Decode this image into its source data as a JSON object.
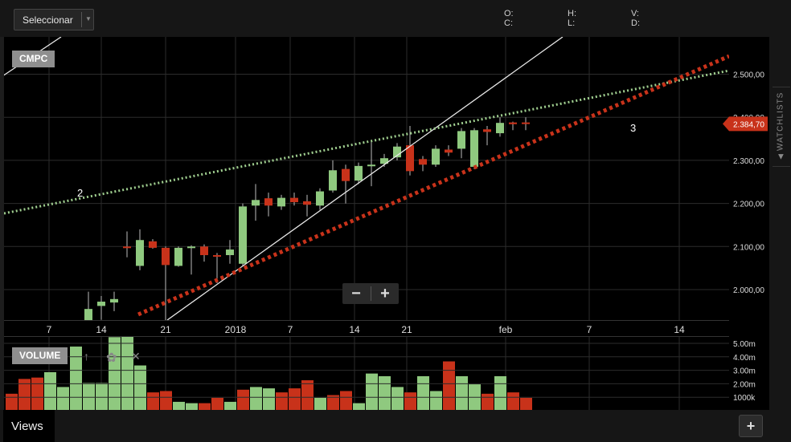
{
  "toolbar": {
    "select_label": "Seleccionar"
  },
  "ohlc_labels": {
    "o": "O:",
    "c": "C:",
    "h": "H:",
    "l": "L:",
    "v": "V:",
    "d": "D:"
  },
  "sidebar": {
    "watchlists_label": "WATCHLISTS"
  },
  "footer": {
    "views_label": "Views",
    "add_label": "+"
  },
  "zoom": {
    "minus": "−",
    "plus": "+"
  },
  "volume_panel": {
    "label": "VOLUME"
  },
  "colors": {
    "up": "#8fc97f",
    "down": "#c8321a",
    "background": "#000000",
    "price_tag": "#c8321a",
    "support_line": "#c8321a",
    "resistance_line": "#9fce8f"
  },
  "chart_data": {
    "type": "candlestick",
    "symbol": "CMPC",
    "last_price_label": "2.384,70",
    "last_price": 2384.7,
    "y_ticks": [
      "2.500,00",
      "2.400,00",
      "2.300,00",
      "2.200,00",
      "2.100,00",
      "2.000,00"
    ],
    "y_values": [
      2500,
      2400,
      2300,
      2200,
      2100,
      2000
    ],
    "x_ticks": [
      "7",
      "14",
      "21",
      "2018",
      "7",
      "14",
      "21",
      "feb",
      "7",
      "14"
    ],
    "ylim": [
      1927,
      2597
    ],
    "candles": [
      {
        "o": 1920,
        "h": 1995,
        "l": 1900,
        "c": 1955
      },
      {
        "o": 1962,
        "h": 1985,
        "l": 1930,
        "c": 1972
      },
      {
        "o": 1970,
        "h": 1995,
        "l": 1950,
        "c": 1978
      },
      {
        "o": 2100,
        "h": 2135,
        "l": 2075,
        "c": 2098
      },
      {
        "o": 2055,
        "h": 2140,
        "l": 2045,
        "c": 2115
      },
      {
        "o": 2112,
        "h": 2117,
        "l": 2095,
        "c": 2097
      },
      {
        "o": 2097,
        "h": 2100,
        "l": 1900,
        "c": 2057
      },
      {
        "o": 2055,
        "h": 2100,
        "l": 2053,
        "c": 2097
      },
      {
        "o": 2098,
        "h": 2103,
        "l": 2035,
        "c": 2100
      },
      {
        "o": 2100,
        "h": 2105,
        "l": 2065,
        "c": 2080
      },
      {
        "o": 2080,
        "h": 2085,
        "l": 2015,
        "c": 2078
      },
      {
        "o": 2080,
        "h": 2115,
        "l": 2060,
        "c": 2093
      },
      {
        "o": 2060,
        "h": 2200,
        "l": 2055,
        "c": 2193
      },
      {
        "o": 2195,
        "h": 2245,
        "l": 2160,
        "c": 2208
      },
      {
        "o": 2212,
        "h": 2225,
        "l": 2170,
        "c": 2195
      },
      {
        "o": 2193,
        "h": 2220,
        "l": 2185,
        "c": 2213
      },
      {
        "o": 2213,
        "h": 2225,
        "l": 2195,
        "c": 2203
      },
      {
        "o": 2205,
        "h": 2220,
        "l": 2170,
        "c": 2197
      },
      {
        "o": 2195,
        "h": 2235,
        "l": 2185,
        "c": 2228
      },
      {
        "o": 2230,
        "h": 2300,
        "l": 2225,
        "c": 2277
      },
      {
        "o": 2280,
        "h": 2290,
        "l": 2200,
        "c": 2252
      },
      {
        "o": 2253,
        "h": 2295,
        "l": 2245,
        "c": 2287
      },
      {
        "o": 2288,
        "h": 2345,
        "l": 2240,
        "c": 2290
      },
      {
        "o": 2292,
        "h": 2315,
        "l": 2285,
        "c": 2305
      },
      {
        "o": 2307,
        "h": 2340,
        "l": 2300,
        "c": 2332
      },
      {
        "o": 2335,
        "h": 2380,
        "l": 2265,
        "c": 2275
      },
      {
        "o": 2303,
        "h": 2310,
        "l": 2275,
        "c": 2290
      },
      {
        "o": 2290,
        "h": 2335,
        "l": 2285,
        "c": 2327
      },
      {
        "o": 2325,
        "h": 2335,
        "l": 2310,
        "c": 2318
      },
      {
        "o": 2327,
        "h": 2375,
        "l": 2305,
        "c": 2368
      },
      {
        "o": 2285,
        "h": 2375,
        "l": 2280,
        "c": 2370
      },
      {
        "o": 2372,
        "h": 2380,
        "l": 2335,
        "c": 2366
      },
      {
        "o": 2363,
        "h": 2400,
        "l": 2355,
        "c": 2387
      },
      {
        "o": 2388,
        "h": 2390,
        "l": 2370,
        "c": 2384
      },
      {
        "o": 2388,
        "h": 2400,
        "l": 2370,
        "c": 2385
      }
    ],
    "volume_ticks": [
      "5.00m",
      "4.00m",
      "3.00m",
      "2.00m",
      "1000k"
    ],
    "volume": [
      {
        "v": 1.2,
        "d": "down"
      },
      {
        "v": 2.3,
        "d": "down"
      },
      {
        "v": 2.4,
        "d": "down"
      },
      {
        "v": 2.8,
        "d": "up"
      },
      {
        "v": 1.7,
        "d": "up"
      },
      {
        "v": 4.7,
        "d": "up"
      },
      {
        "v": 2.0,
        "d": "up"
      },
      {
        "v": 2.0,
        "d": "up"
      },
      {
        "v": 5.4,
        "d": "up"
      },
      {
        "v": 5.6,
        "d": "up"
      },
      {
        "v": 3.3,
        "d": "up"
      },
      {
        "v": 1.3,
        "d": "down"
      },
      {
        "v": 1.4,
        "d": "down"
      },
      {
        "v": 0.6,
        "d": "up"
      },
      {
        "v": 0.5,
        "d": "up"
      },
      {
        "v": 0.5,
        "d": "down"
      },
      {
        "v": 0.9,
        "d": "down"
      },
      {
        "v": 0.6,
        "d": "up"
      },
      {
        "v": 1.5,
        "d": "down"
      },
      {
        "v": 1.7,
        "d": "up"
      },
      {
        "v": 1.6,
        "d": "up"
      },
      {
        "v": 1.3,
        "d": "down"
      },
      {
        "v": 1.6,
        "d": "down"
      },
      {
        "v": 2.2,
        "d": "down"
      },
      {
        "v": 0.9,
        "d": "up"
      },
      {
        "v": 1.1,
        "d": "down"
      },
      {
        "v": 1.4,
        "d": "down"
      },
      {
        "v": 0.5,
        "d": "up"
      },
      {
        "v": 2.7,
        "d": "up"
      },
      {
        "v": 2.5,
        "d": "up"
      },
      {
        "v": 1.7,
        "d": "up"
      },
      {
        "v": 1.3,
        "d": "down"
      },
      {
        "v": 2.5,
        "d": "up"
      },
      {
        "v": 1.4,
        "d": "up"
      },
      {
        "v": 3.6,
        "d": "down"
      },
      {
        "v": 2.5,
        "d": "up"
      },
      {
        "v": 1.9,
        "d": "up"
      },
      {
        "v": 1.2,
        "d": "down"
      },
      {
        "v": 2.5,
        "d": "up"
      },
      {
        "v": 1.3,
        "d": "down"
      },
      {
        "v": 0.9,
        "d": "down"
      }
    ],
    "annotations": [
      "2",
      "3"
    ],
    "trend_lines": [
      {
        "name": "resistance",
        "style": "dotted",
        "color": "#9fce8f"
      },
      {
        "name": "support",
        "style": "dotted-thick",
        "color": "#c8321a"
      },
      {
        "name": "trend",
        "style": "solid",
        "color": "#e8e8e8"
      }
    ],
    "grid": true
  }
}
